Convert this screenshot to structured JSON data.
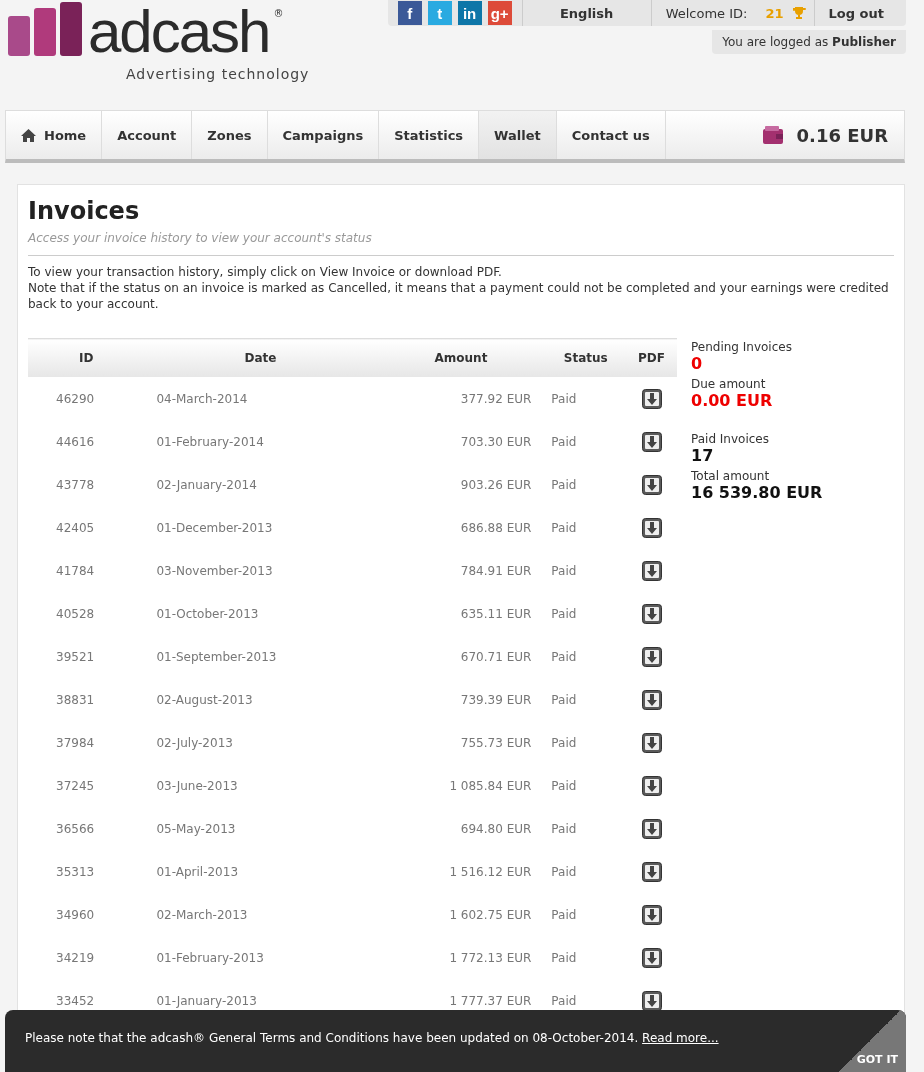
{
  "logo": {
    "name": "adcash",
    "mark": "®",
    "tagline": "Advertising technology"
  },
  "topbar": {
    "social": [
      {
        "kind": "facebook",
        "glyph": "f"
      },
      {
        "kind": "twitter",
        "glyph": "t"
      },
      {
        "kind": "linkedin",
        "glyph": "in"
      },
      {
        "kind": "googleplus",
        "glyph": "g+"
      }
    ],
    "language": "English",
    "welcome_label": "Welcome ID:",
    "welcome_id": "21",
    "logout": "Log out",
    "logged_as": "You are logged as",
    "role": "Publisher"
  },
  "nav": {
    "items": [
      {
        "label": "Home",
        "kind": "home",
        "selected": false
      },
      {
        "label": "Account",
        "selected": false
      },
      {
        "label": "Zones",
        "selected": false
      },
      {
        "label": "Campaigns",
        "selected": false
      },
      {
        "label": "Statistics",
        "selected": false
      },
      {
        "label": "Wallet",
        "selected": true
      },
      {
        "label": "Contact us",
        "selected": false
      }
    ],
    "balance": "0.16 EUR"
  },
  "page": {
    "title": "Invoices",
    "subtitle": "Access your invoice history to view your account's status",
    "intro": [
      "To view your transaction history, simply click on View Invoice or download PDF.",
      "Note that if the status on an invoice is marked as Cancelled, it means that a payment could not be completed and your earnings were credited back to your account."
    ]
  },
  "table": {
    "columns": [
      "ID",
      "Date",
      "Amount",
      "Status",
      "PDF"
    ],
    "rows": [
      [
        "46290",
        "04-March-2014",
        "377.92 EUR",
        "Paid"
      ],
      [
        "44616",
        "01-February-2014",
        "703.30 EUR",
        "Paid"
      ],
      [
        "43778",
        "02-January-2014",
        "903.26 EUR",
        "Paid"
      ],
      [
        "42405",
        "01-December-2013",
        "686.88 EUR",
        "Paid"
      ],
      [
        "41784",
        "03-November-2013",
        "784.91 EUR",
        "Paid"
      ],
      [
        "40528",
        "01-October-2013",
        "635.11 EUR",
        "Paid"
      ],
      [
        "39521",
        "01-September-2013",
        "670.71 EUR",
        "Paid"
      ],
      [
        "38831",
        "02-August-2013",
        "739.39 EUR",
        "Paid"
      ],
      [
        "37984",
        "02-July-2013",
        "755.73 EUR",
        "Paid"
      ],
      [
        "37245",
        "03-June-2013",
        "1 085.84 EUR",
        "Paid"
      ],
      [
        "36566",
        "05-May-2013",
        "694.80 EUR",
        "Paid"
      ],
      [
        "35313",
        "01-April-2013",
        "1 516.12 EUR",
        "Paid"
      ],
      [
        "34960",
        "02-March-2013",
        "1 602.75 EUR",
        "Paid"
      ],
      [
        "34219",
        "01-February-2013",
        "1 772.13 EUR",
        "Paid"
      ],
      [
        "33452",
        "01-January-2013",
        "1 777.37 EUR",
        "Paid"
      ]
    ]
  },
  "summary": [
    {
      "label": "Pending Invoices",
      "value": "0",
      "alert": true
    },
    {
      "label": "Due amount",
      "value": "0.00 EUR",
      "alert": true
    },
    {
      "label": "Paid Invoices",
      "value": "17",
      "alert": false
    },
    {
      "label": "Total amount",
      "value": "16 539.80 EUR",
      "alert": false
    }
  ],
  "notice": {
    "text": "Please note that the adcash® General Terms and Conditions have been updated on 08-October-2014.",
    "link": "Read more...",
    "button": "GOT IT"
  }
}
